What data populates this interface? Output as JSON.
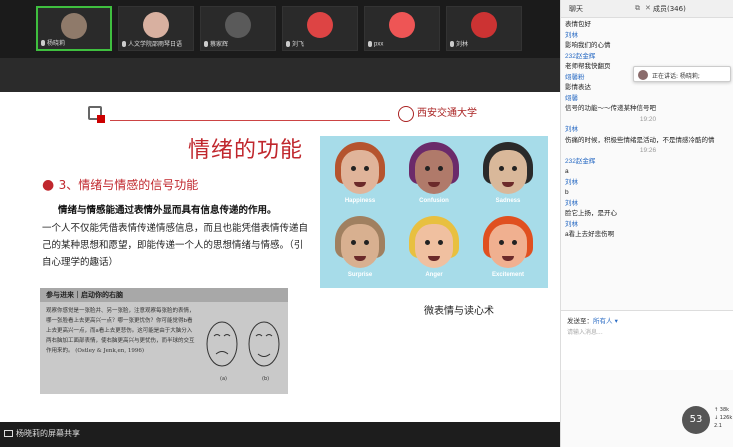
{
  "participants": [
    {
      "name": "杨晓莉",
      "active": true,
      "color": "#8f7a6a"
    },
    {
      "name": "人文学院邵雨琴日语",
      "active": false,
      "color": "#d8b0a0"
    },
    {
      "name": "蔡家辉",
      "active": false,
      "color": "#5a5a5a"
    },
    {
      "name": "刘飞",
      "active": false,
      "color": "#d44"
    },
    {
      "name": "pxx",
      "active": false,
      "color": "#e55"
    },
    {
      "name": "刘林",
      "active": false,
      "color": "#c33"
    }
  ],
  "slide": {
    "title": "情绪的功能",
    "subtitle": "3、情绪与情感的信号功能",
    "para1": "情绪与情感能通过表情外显而具有信息传递的作用。",
    "para2": "一个人不仅能凭借表情传递情感信息，而且也能凭借表情传递自己的某种思想和愿望，即能传递一个人的思想情绪与情感。（引自心理学的趣话）",
    "logo_text": "西安交通大学",
    "caption": "微表情与读心术",
    "book_header": "参与进来｜启动你的右脑",
    "book_text": "观察你感觉是一张脸并、另一张脸，注意观察每张脸的表情，哪一张脸看上去更高兴一点？哪一张更忧伤？你可能觉得b看上去更高兴一点，而a看上去更悲伤。这可能是由于大脑分入两右脑加工面部表情，使右脑更高兴与更忧伤，而半球的交互作用来的。 (Ostley & Jenk,en, 1996)",
    "faces": [
      {
        "label": "Happiness",
        "hair": "#b5542e",
        "skin": "#e0b49a"
      },
      {
        "label": "Confusion",
        "hair": "#6b2a6a",
        "skin": "#b07a6a"
      },
      {
        "label": "Sadness",
        "hair": "#2a2a2a",
        "skin": "#d9b89a"
      },
      {
        "label": "Surprise",
        "hair": "#a08060",
        "skin": "#d8b090"
      },
      {
        "label": "Anger",
        "hair": "#e8c040",
        "skin": "#f0c0a0"
      },
      {
        "label": "Excitement",
        "hair": "#e05020",
        "skin": "#f0b090"
      }
    ]
  },
  "share_status": "杨晓莉的屏幕共享",
  "chat": {
    "title": "聊天",
    "members": "成员(346)",
    "speaking": "正在讲话: 杨晓莉;",
    "messages": [
      {
        "t": "body",
        "v": "表情包好"
      },
      {
        "t": "name",
        "v": "刘林"
      },
      {
        "t": "body",
        "v": "影响我们的心情"
      },
      {
        "t": "name",
        "v": "232赵金辉"
      },
      {
        "t": "body",
        "v": "老师帮我快翻页"
      },
      {
        "t": "name",
        "v": "翊馨粉"
      },
      {
        "t": "body",
        "v": "影情表达"
      },
      {
        "t": "name",
        "v": "翊馨"
      },
      {
        "t": "body",
        "v": "信号的功能～～传递某种信号吧"
      },
      {
        "t": "time",
        "v": "19:20"
      },
      {
        "t": "name",
        "v": "刘林"
      },
      {
        "t": "body",
        "v": "伤痛的时候，积极些情绪是活动，不是情感冷酷的情"
      },
      {
        "t": "time",
        "v": "19:26"
      },
      {
        "t": "name",
        "v": "232赵金辉"
      },
      {
        "t": "body",
        "v": "a"
      },
      {
        "t": "name",
        "v": "刘林"
      },
      {
        "t": "body",
        "v": "b"
      },
      {
        "t": "name",
        "v": "刘林"
      },
      {
        "t": "body",
        "v": "脸它上扬，是开心"
      },
      {
        "t": "name",
        "v": "刘林"
      },
      {
        "t": "body",
        "v": "a看上去好悲伤啊"
      }
    ],
    "send_to_label": "发送至：",
    "send_to_target": "所有人 ▾",
    "input_placeholder": "请输入消息..."
  },
  "timer": "53",
  "stats": [
    "↑ 38k",
    "↓ 126k",
    "2.1"
  ]
}
